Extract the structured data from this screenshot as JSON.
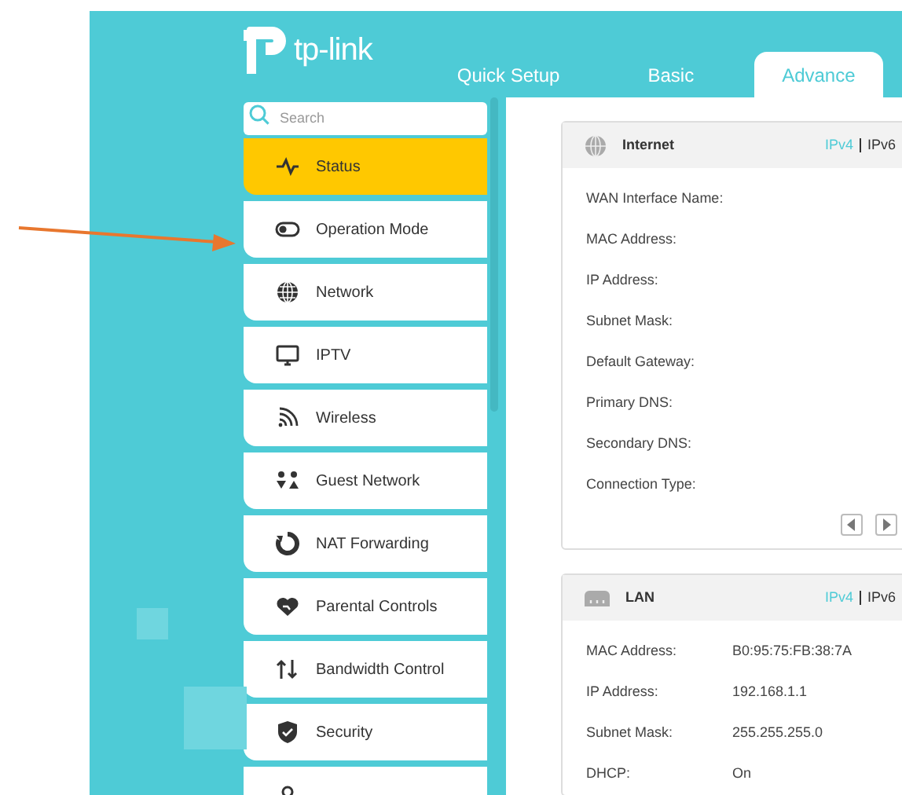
{
  "logo": {
    "text": "tp-link"
  },
  "tabs": [
    {
      "label": "Quick Setup",
      "selected": false
    },
    {
      "label": "Basic",
      "selected": false
    },
    {
      "label": "Advance",
      "selected": true
    }
  ],
  "search": {
    "placeholder": "Search"
  },
  "sidebar": {
    "items": [
      {
        "label": "Status",
        "selected": true
      },
      {
        "label": "Operation Mode",
        "selected": false
      },
      {
        "label": "Network",
        "selected": false
      },
      {
        "label": "IPTV",
        "selected": false
      },
      {
        "label": "Wireless",
        "selected": false
      },
      {
        "label": "Guest Network",
        "selected": false
      },
      {
        "label": "NAT Forwarding",
        "selected": false
      },
      {
        "label": "Parental Controls",
        "selected": false
      },
      {
        "label": "Bandwidth Control",
        "selected": false
      },
      {
        "label": "Security",
        "selected": false
      },
      {
        "selected": false
      }
    ]
  },
  "cards": [
    {
      "title": "Internet",
      "versions": [
        {
          "label": "IPv4",
          "selected": true
        },
        {
          "label": "IPv6",
          "selected": false
        }
      ],
      "rows": [
        {
          "label": "WAN Interface Name:"
        },
        {
          "label": "MAC Address:"
        },
        {
          "label": "IP Address:"
        },
        {
          "label": "Subnet Mask:"
        },
        {
          "label": "Default Gateway:"
        },
        {
          "label": "Primary DNS:"
        },
        {
          "label": "Secondary DNS:"
        },
        {
          "label": "Connection Type:"
        }
      ],
      "pager": true
    },
    {
      "title": "LAN",
      "versions": [
        {
          "label": "IPv4",
          "selected": true
        },
        {
          "label": "IPv6",
          "selected": false
        }
      ],
      "rows": [
        {
          "label": "MAC Address:",
          "value": "B0:95:75:FB:38:7A"
        },
        {
          "label": "IP Address:",
          "value": "192.168.1.1"
        },
        {
          "label": "Subnet Mask:",
          "value": "255.255.255.0"
        },
        {
          "label": "DHCP:",
          "value": "On"
        }
      ],
      "pager": false
    }
  ]
}
